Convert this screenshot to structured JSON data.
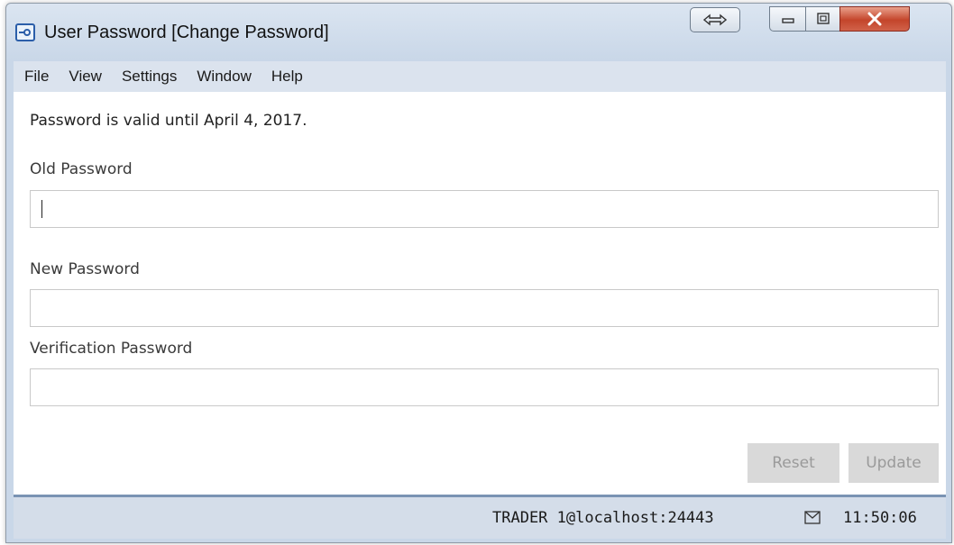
{
  "window": {
    "title": "User Password [Change Password]",
    "icon": "key-icon",
    "controls": [
      "resize-icon",
      "minimize-icon",
      "maximize-icon",
      "close-icon"
    ]
  },
  "menu": {
    "items": [
      {
        "label": "File"
      },
      {
        "label": "View"
      },
      {
        "label": "Settings"
      },
      {
        "label": "Window"
      },
      {
        "label": "Help"
      }
    ]
  },
  "form": {
    "valid_message": "Password is valid until April 4, 2017.",
    "old_password": {
      "label": "Old Password",
      "value": ""
    },
    "new_password": {
      "label": "New Password",
      "value": ""
    },
    "verification_password": {
      "label": "Verification Password",
      "value": ""
    },
    "reset_label": "Reset",
    "update_label": "Update"
  },
  "status": {
    "connection": "TRADER 1@localhost:24443",
    "mail_icon": "envelope-icon",
    "time": "11:50:06"
  },
  "colors": {
    "titlebar": "#c9d7e8",
    "status_divider": "#7a93b3",
    "disabled_button": "#d9d9d9",
    "close_button": "#c4452b"
  }
}
